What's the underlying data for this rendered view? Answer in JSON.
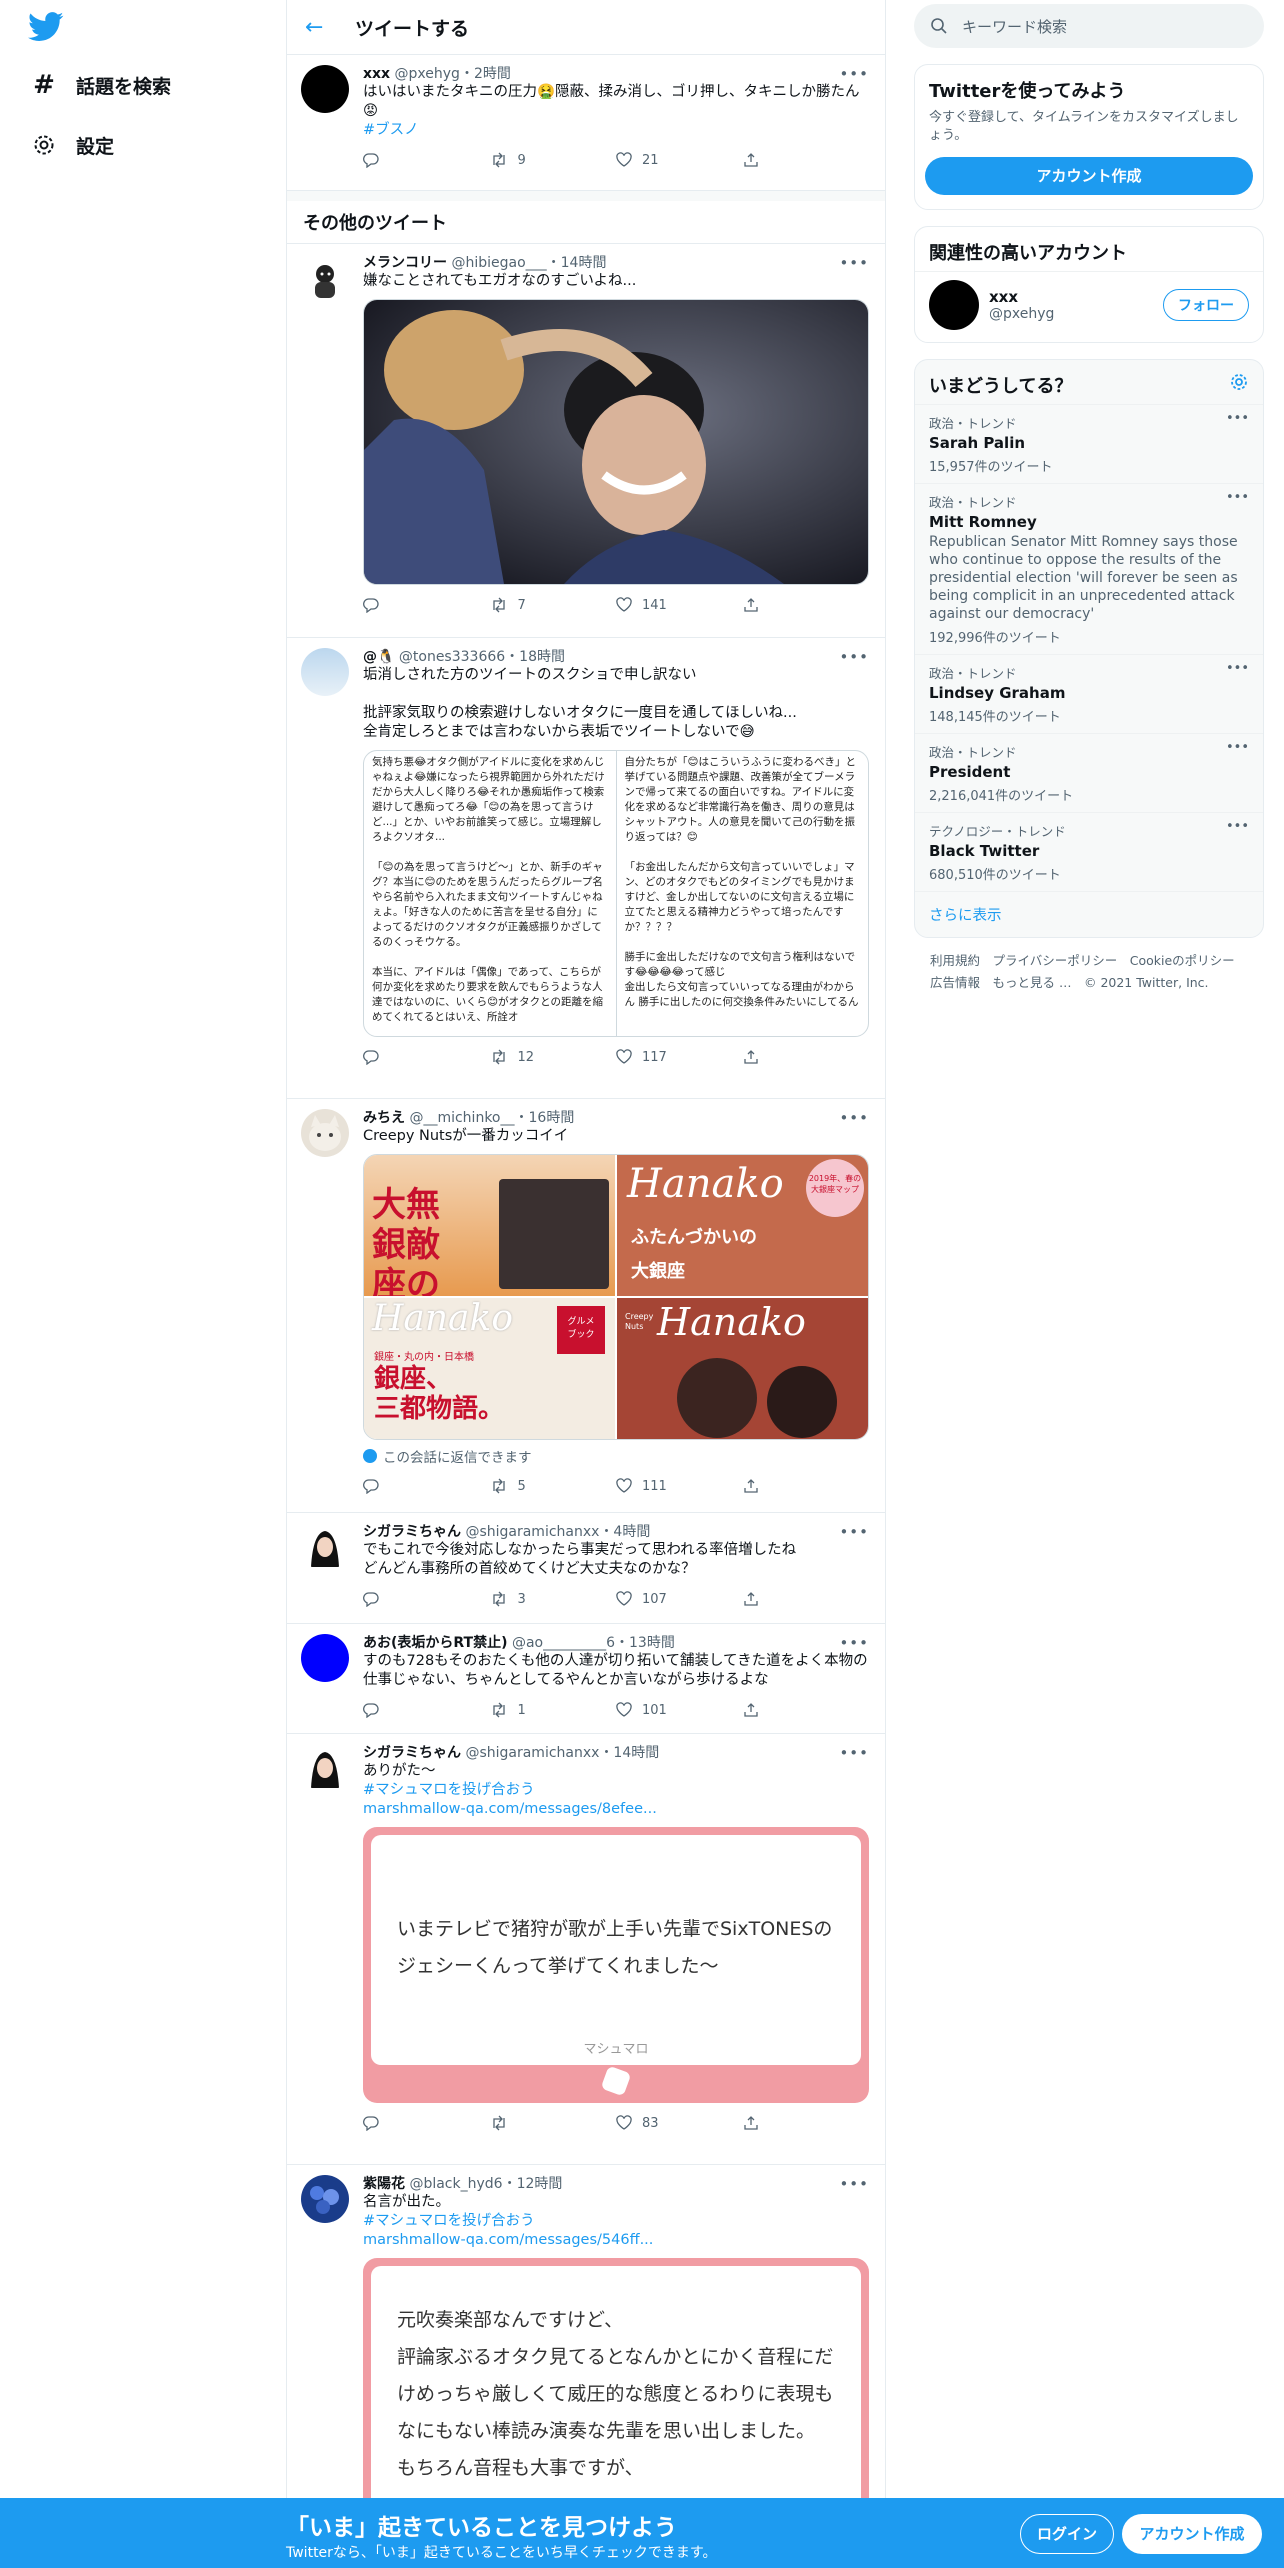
{
  "nav": {
    "search_label": "話題を検索",
    "settings_label": "設定"
  },
  "header": {
    "title": "ツイートする"
  },
  "main_tweet": {
    "name": "xxx",
    "handle": "@pxehyg",
    "time": "・2時間",
    "text": "はいはいまたタキニの圧力🤮隠蔽、揉み消し、ゴリ押し、タキニしか勝たん😡",
    "hashtag": "#ブスノ",
    "retweets": "9",
    "likes": "21"
  },
  "other_section_title": "その他のツイート",
  "tweets": [
    {
      "name": "メランコリー",
      "handle": "@hibiegao___",
      "time": "・14時間",
      "text": "嫌なことされてもエガオなのすごいよね...",
      "retweets": "7",
      "likes": "141"
    },
    {
      "name": "@🐧",
      "handle": "@tones333666",
      "time": "・18時間",
      "text": "垢消しされた方のツイートのスクショで申し訳ない\n\n批評家気取りの検索避けしないオタクに一度目を通してほしいね...\n全肯定しろとまでは言わないから表垢でツイートしないで😅",
      "screenshot_left": "気持ち悪😂オタク側がアイドルに変化を求めんじゃねぇよ😂嫌になったら視界範囲から外れただけだから大人しく降りろ😂それか愚痴垢作って検索避けして愚痴ってろ😂「😊の為を思って言うけど...」とか、いやお前誰笑って感じ。立場理解しろよクソオタ...\n\n「😊の為を思って言うけど〜」とか、新手のギャグ？本当に😊のためを思うんだったらグループ名やら名前やら入れたまま文句ツイートすんじゃねぇよ。「好きな人のために苦言を呈せる自分」によってるだけのクソオタクが正義感振りかざしてるのくっそウケる。\n\n本当に、アイドルは「偶像」であって、こちらが何か変化を求めたり要求を飲んでもらうような人達ではないのに、いくら😊がオタクとの距離を縮めてくれてるとはいえ、所詮オ",
      "screenshot_right": "自分たちが「😊はこういうふうに変わるべき」と挙げている問題点や課題、改善策が全てブーメランで帰って来てるの面白いですね。アイドルに変化を求めるなど非常識行為を働き、周りの意見はシャットアウト。人の意見を聞いて己の行動を振り返っては？😊\n\n「お金出したんだから文句言っていいでしょ」マン、どのオタクでもどのタイミングでも見かけますけど、金しか出してないのに文句言える立場に立てたと思える精神力どうやって培ったんですか？？？？\n\n勝手に金出しただけなので文句言う権利はないです😂😂😂😂って感じ\n金出したら文句言っていいってなる理由がわからん 勝手に出したのに何交換条件みたいにしてるん",
      "retweets": "12",
      "likes": "117"
    },
    {
      "name": "みちえ",
      "handle": "@__michinko__",
      "time": "・16時間",
      "text": "Creepy Nutsが一番カッコイイ",
      "mag1_title": "大無\n銀敵\n座の",
      "mag2_brand": "Hanako",
      "mag2_title": "ふたんづかいの\n大銀座",
      "mag2_badge": "2019年、春の\n大銀座マップ",
      "mag3_brand": "Hanako",
      "mag3_title": "銀座、\n三都物語。",
      "mag3_sub": "銀座・丸の内・日本橋",
      "mag3_badge": "グルメ\nブック",
      "mag4_brand": "Hanako",
      "mag4_tag": "Creepy\nNuts",
      "reply_notice": "この会話に返信できます",
      "retweets": "5",
      "likes": "111"
    },
    {
      "name": "シガラミちゃん",
      "handle": "@shigaramichanxx",
      "time": "・4時間",
      "text": "でもこれで今後対応しなかったら事実だって思われる率倍増したね\nどんどん事務所の首絞めてくけど大丈夫なのかな？",
      "retweets": "3",
      "likes": "107"
    },
    {
      "name": "あお(表垢からRT禁止)",
      "handle": "@ao_________6",
      "time": "・13時間",
      "text": "すのも728もそのおたくも他の人達が切り拓いて舗装してきた道をよく本物の仕事じゃない、ちゃんとしてるやんとか言いながら歩けるよな",
      "retweets": "1",
      "likes": "101"
    },
    {
      "name": "シガラミちゃん",
      "handle": "@shigaramichanxx",
      "time": "・14時間",
      "text": "ありがた〜",
      "hashtag": "#マシュマロを投げ合おう",
      "link": "marshmallow-qa.com/messages/8efee...",
      "card_text": "いまテレビで猪狩が歌が上手い先輩でSixTONESのジェシーくんって挙げてくれました〜",
      "card_label": "マシュマロ",
      "retweets": "",
      "likes": "83"
    },
    {
      "name": "紫陽花",
      "handle": "@black_hyd6",
      "time": "・12時間",
      "text": "名言が出た。",
      "hashtag": "#マシュマロを投げ合おう",
      "link": "marshmallow-qa.com/messages/546ff...",
      "card_text": "元吹奏楽部なんですけど、\n評論家ぶるオタク見てるとなんかとにかく音程にだけめっちゃ厳しくて威圧的な態度とるわりに表現もなにもない棒読み演奏な先輩を思い出しました。\nもちろん音程も大事ですが、"
    }
  ],
  "right": {
    "search_placeholder": "キーワード検索",
    "signup_title": "Twitterを使ってみよう",
    "signup_desc": "今すぐ登録して、タイムラインをカスタマイズしましょう。",
    "signup_button": "アカウント作成",
    "related_title": "関連性の高いアカウント",
    "related_name": "xxx",
    "related_handle": "@pxehyg",
    "follow_button": "フォロー",
    "trends_title": "いまどうしてる？",
    "trends": [
      {
        "cat": "政治・トレンド",
        "name": "Sarah Palin",
        "desc": "",
        "count": "15,957件のツイート"
      },
      {
        "cat": "政治・トレンド",
        "name": "Mitt Romney",
        "desc": "Republican Senator Mitt Romney says those who continue to oppose the results of the presidential election 'will forever be seen as being complicit in an unprecedented attack against our democracy'",
        "count": "192,996件のツイート"
      },
      {
        "cat": "政治・トレンド",
        "name": "Lindsey Graham",
        "desc": "",
        "count": "148,145件のツイート"
      },
      {
        "cat": "政治・トレンド",
        "name": "President",
        "desc": "",
        "count": "2,216,041件のツイート"
      },
      {
        "cat": "テクノロジー・トレンド",
        "name": "Black Twitter",
        "desc": "",
        "count": "680,510件のツイート"
      }
    ],
    "show_more": "さらに表示",
    "footer_line1": "利用規約　プライバシーポリシー　Cookieのポリシー",
    "footer_line2": "広告情報　もっと見る …　© 2021 Twitter, Inc."
  },
  "bottom": {
    "title": "「いま」起きていることを見つけよう",
    "subtitle": "Twitterなら、「いま」起きていることをいち早くチェックできます。",
    "login": "ログイン",
    "signup": "アカウント作成"
  }
}
